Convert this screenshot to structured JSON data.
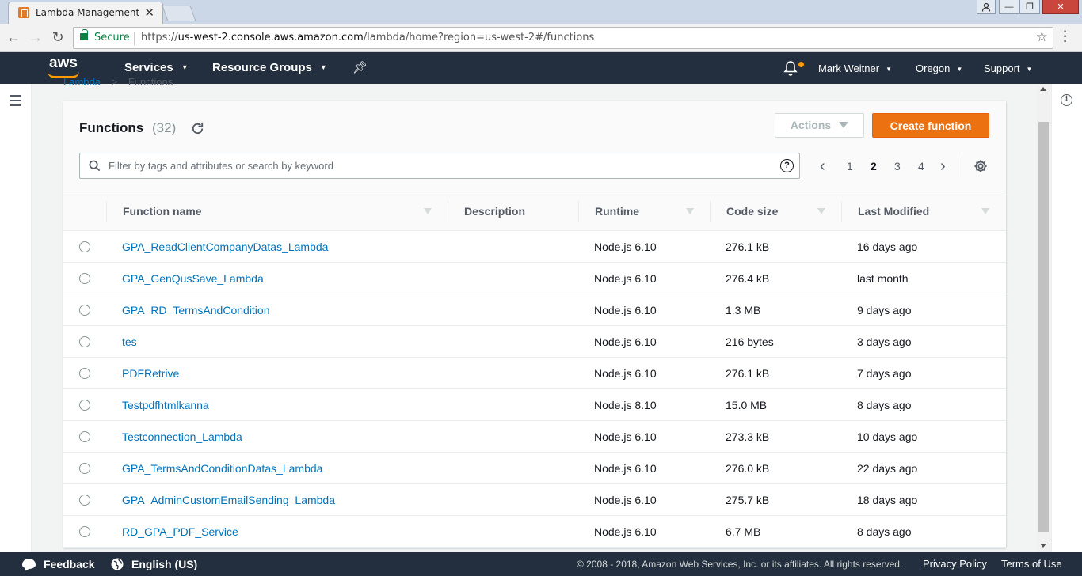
{
  "browser": {
    "tab_title": "Lambda Management Co",
    "secure_label": "Secure",
    "url_scheme": "https://",
    "url_host": "us-west-2.console.aws.amazon.com",
    "url_path": "/lambda/home?region=us-west-2#/functions"
  },
  "aws_nav": {
    "logo_text": "aws",
    "services_label": "Services",
    "resource_groups_label": "Resource Groups",
    "user_label": "Mark Weitner",
    "region_label": "Oregon",
    "support_label": "Support",
    "accent_color": "#ff9900"
  },
  "breadcrumb": {
    "parent": "Lambda",
    "separator": ">",
    "current": "Functions"
  },
  "panel": {
    "title": "Functions",
    "count": "(32)",
    "actions_label": "Actions",
    "create_label": "Create function",
    "search_placeholder": "Filter by tags and attributes or search by keyword",
    "help_glyph": "?"
  },
  "pagination": {
    "prev": "‹",
    "next": "›",
    "pages": [
      "1",
      "2",
      "3",
      "4"
    ],
    "current_page": "2"
  },
  "table": {
    "columns": [
      "Function name",
      "Description",
      "Runtime",
      "Code size",
      "Last Modified"
    ],
    "rows": [
      {
        "name": "GPA_ReadClientCompanyDatas_Lambda",
        "description": "",
        "runtime": "Node.js 6.10",
        "code_size": "276.1 kB",
        "last_modified": "16 days ago"
      },
      {
        "name": "GPA_GenQusSave_Lambda",
        "description": "",
        "runtime": "Node.js 6.10",
        "code_size": "276.4 kB",
        "last_modified": "last month"
      },
      {
        "name": "GPA_RD_TermsAndCondition",
        "description": "",
        "runtime": "Node.js 6.10",
        "code_size": "1.3 MB",
        "last_modified": "9 days ago"
      },
      {
        "name": "tes",
        "description": "",
        "runtime": "Node.js 6.10",
        "code_size": "216 bytes",
        "last_modified": "3 days ago"
      },
      {
        "name": "PDFRetrive",
        "description": "",
        "runtime": "Node.js 6.10",
        "code_size": "276.1 kB",
        "last_modified": "7 days ago"
      },
      {
        "name": "Testpdfhtmlkanna",
        "description": "",
        "runtime": "Node.js 8.10",
        "code_size": "15.0 MB",
        "last_modified": "8 days ago"
      },
      {
        "name": "Testconnection_Lambda",
        "description": "",
        "runtime": "Node.js 6.10",
        "code_size": "273.3 kB",
        "last_modified": "10 days ago"
      },
      {
        "name": "GPA_TermsAndConditionDatas_Lambda",
        "description": "",
        "runtime": "Node.js 6.10",
        "code_size": "276.0 kB",
        "last_modified": "22 days ago"
      },
      {
        "name": "GPA_AdminCustomEmailSending_Lambda",
        "description": "",
        "runtime": "Node.js 6.10",
        "code_size": "275.7 kB",
        "last_modified": "18 days ago"
      },
      {
        "name": "RD_GPA_PDF_Service",
        "description": "",
        "runtime": "Node.js 6.10",
        "code_size": "6.7 MB",
        "last_modified": "8 days ago"
      }
    ]
  },
  "footer": {
    "feedback_label": "Feedback",
    "language_label": "English (US)",
    "copyright": "© 2008 - 2018, Amazon Web Services, Inc. or its affiliates. All rights reserved.",
    "privacy_label": "Privacy Policy",
    "terms_label": "Terms of Use"
  },
  "colors": {
    "nav_bg": "#232f3e",
    "primary_button": "#ec7211",
    "link": "#0073bb"
  }
}
